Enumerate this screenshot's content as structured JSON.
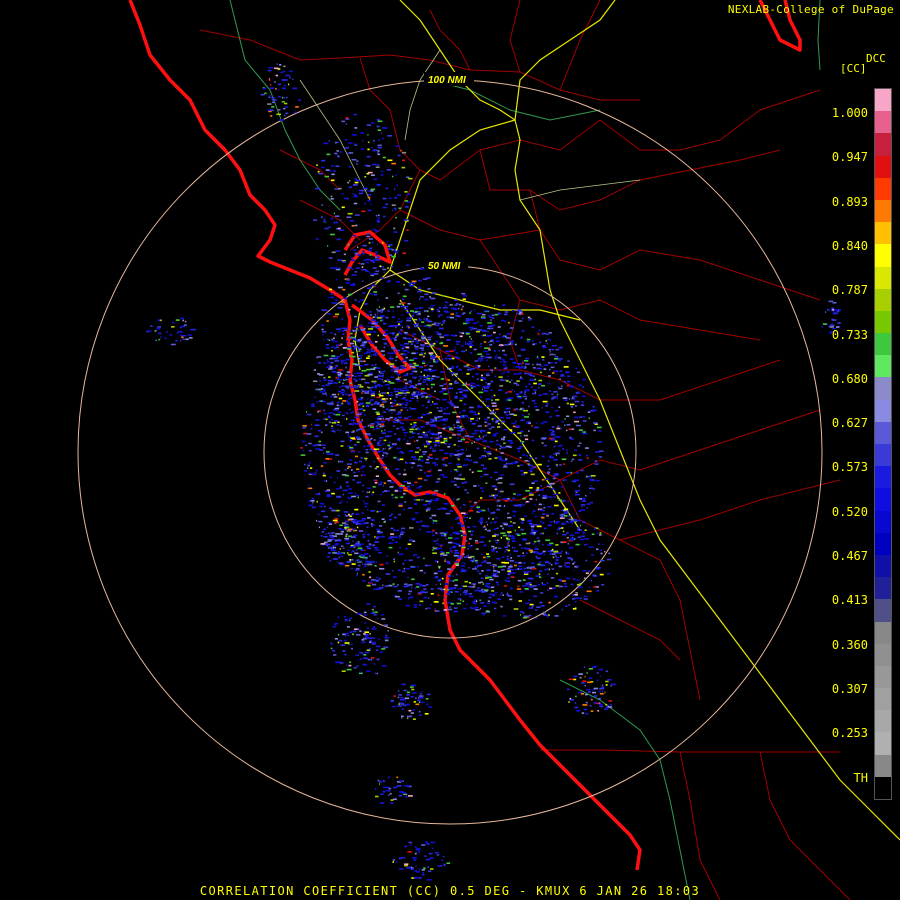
{
  "credit": "NEXLAB-College of DuPage",
  "product_code": "[CC]",
  "legend_title": "DCC",
  "range_rings": [
    {
      "label": "100 NMI"
    },
    {
      "label": "50 NMI"
    }
  ],
  "legend": {
    "ticks": [
      "1.000",
      "0.947",
      "0.893",
      "0.840",
      "0.787",
      "0.733",
      "0.680",
      "0.627",
      "0.573",
      "0.520",
      "0.467",
      "0.413",
      "0.360",
      "0.307",
      "0.253",
      "TH"
    ],
    "colors": [
      "#f7a6c8",
      "#e8608e",
      "#c8203c",
      "#e01010",
      "#ff3a00",
      "#ff7a00",
      "#ffc000",
      "#ffff00",
      "#d8e800",
      "#a8d000",
      "#78c800",
      "#3ec83e",
      "#5ee85e",
      "#8a8ac8",
      "#8a8ae0",
      "#5a5ad8",
      "#3a3ad8",
      "#1a1ae0",
      "#0e0ee0",
      "#0808d0",
      "#0000c0",
      "#1010a8",
      "#202098",
      "#505088",
      "#888888",
      "#909090",
      "#989898",
      "#a0a0a0",
      "#a8a8a8",
      "#b0b0b0",
      "#888888",
      "#000000"
    ]
  },
  "footer": "CORRELATION COEFFICIENT (CC) 0.5 DEG - KMUX 6 JAN 26 18:03"
}
